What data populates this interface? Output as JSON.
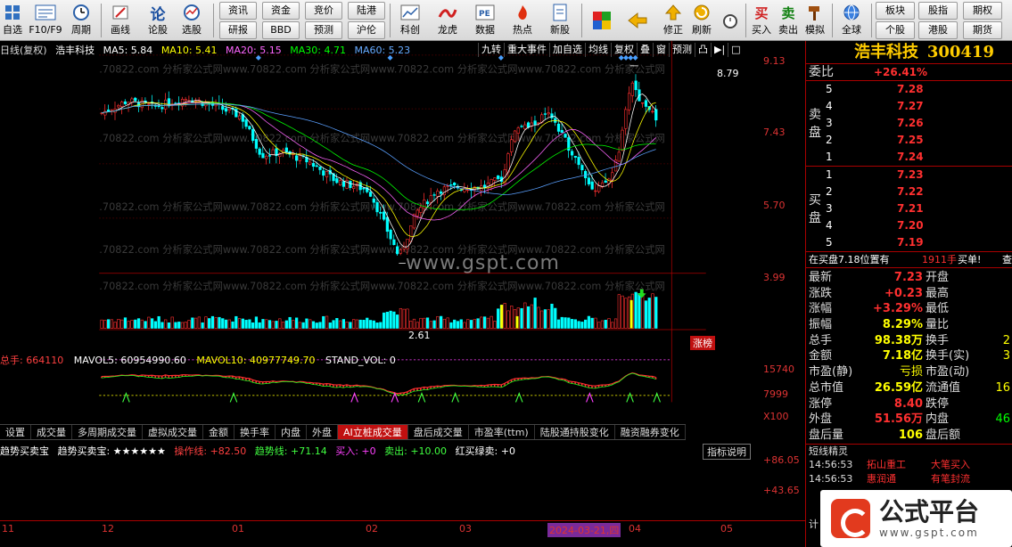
{
  "toolbar": {
    "buttons": [
      {
        "label": "自选",
        "icon": "grid-icon"
      },
      {
        "label": "F10/F9",
        "icon": "f10-icon"
      },
      {
        "label": "周期",
        "icon": "clock-icon"
      },
      {
        "label": "画线",
        "icon": "pencil-icon"
      },
      {
        "label": "论股",
        "icon": "discuss-icon"
      },
      {
        "label": "选股",
        "icon": "radar-icon"
      }
    ],
    "pairs": [
      [
        "资讯",
        "研报"
      ],
      [
        "资金",
        "BBD"
      ],
      [
        "竞价",
        "预测"
      ],
      [
        "陆港",
        "沪伦"
      ]
    ],
    "buttons2": [
      {
        "label": "科创",
        "icon": "chart-icon"
      },
      {
        "label": "龙虎",
        "icon": "dragon-icon"
      },
      {
        "label": "数据",
        "icon": "pe-icon"
      },
      {
        "label": "热点",
        "icon": "fire-icon"
      },
      {
        "label": "新股",
        "icon": "new-stock-icon"
      }
    ],
    "buttons3": [
      {
        "label": "",
        "icon": "layout-icon"
      },
      {
        "label": "",
        "icon": "back-arrow-icon"
      },
      {
        "label": "修正",
        "icon": "up-arrow-icon"
      },
      {
        "label": "刷新",
        "icon": "refresh-icon"
      },
      {
        "label": "",
        "icon": "alarm-clock-icon"
      },
      {
        "label": "买入",
        "icon": "buy-icon"
      },
      {
        "label": "卖出",
        "icon": "sell-icon"
      },
      {
        "label": "模拟",
        "icon": "hammer-icon"
      },
      {
        "label": "全球",
        "icon": "globe-icon"
      }
    ],
    "pairs2": [
      [
        "板块",
        "个股"
      ],
      [
        "股指",
        "港股"
      ],
      [
        "期权",
        "期货"
      ]
    ]
  },
  "chart_header": {
    "period": "日线(复权)",
    "stock": "浩丰科技",
    "ma5": "MA5: 5.84",
    "ma10": "MA10: 5.41",
    "ma20": "MA20: 5.15",
    "ma30": "MA30: 4.71",
    "ma60": "MA60: 5.23",
    "menu": [
      "九转",
      "重大事件",
      "加自选",
      "均线",
      "复权",
      "叠",
      "窗",
      "预测",
      "凸",
      "▶|",
      "□"
    ]
  },
  "price_axis": [
    "9.13",
    "7.43",
    "5.70",
    "3.99"
  ],
  "annotations": {
    "high": "8.79",
    "low": "2.61",
    "tag": "涨榜"
  },
  "watermark": "www.gspt.com",
  "volume_header": {
    "total": "总手: 664110",
    "mavol5": "MAVOL5: 60954990.60",
    "mavol10": "MAVOL10: 40977749.70",
    "stand": "STAND_VOL: 0"
  },
  "volume_axis": [
    "15740",
    "7999",
    "X100"
  ],
  "tabs": [
    "设置",
    "成交量",
    "多周期成交量",
    "虚拟成交量",
    "金额",
    "换手率",
    "内盘",
    "外盘",
    "AI立桩成交量",
    "盘后成交量",
    "市盈率(ttm)",
    "陆股通持股变化",
    "融资融券变化"
  ],
  "active_tab": "AI立桩成交量",
  "indicator_header": {
    "name": "趋势买卖宝",
    "sub": "趋势买卖宝: ★★★★★★",
    "op": "操作线: +82.50",
    "trend": "趋势线: +71.14",
    "buy": "买入: +0",
    "sell": "卖出: +10.00",
    "rb": "红买绿卖: +0",
    "help": "指标说明"
  },
  "indicator_axis": [
    "+86.05",
    "+43.65"
  ],
  "date_axis": [
    "11",
    "12",
    "01",
    "02",
    "03",
    "04",
    "05"
  ],
  "date_highlight": "2024-03-21,四",
  "panel": {
    "name": "浩丰科技",
    "code": "300419",
    "commission_label": "委比",
    "commission_value": "+26.41%",
    "sell_label": "卖盘",
    "buy_label": "买盘",
    "sell_rows": [
      {
        "level": "5",
        "price": "7.28"
      },
      {
        "level": "4",
        "price": "7.27"
      },
      {
        "level": "3",
        "price": "7.26"
      },
      {
        "level": "2",
        "price": "7.25"
      },
      {
        "level": "1",
        "price": "7.24"
      }
    ],
    "buy_rows": [
      {
        "level": "1",
        "price": "7.23"
      },
      {
        "level": "2",
        "price": "7.22"
      },
      {
        "level": "3",
        "price": "7.21"
      },
      {
        "level": "4",
        "price": "7.20"
      },
      {
        "level": "5",
        "price": "7.19"
      }
    ],
    "status": {
      "text": "在买盘7.18位置有",
      "qty": "1911手",
      "action": "买单!",
      "extra": "查"
    },
    "quotes": [
      {
        "l1": "最新",
        "v1": "7.23",
        "l2": "开盘",
        "v2": ""
      },
      {
        "l1": "涨跌",
        "v1": "+0.23",
        "l2": "最高",
        "v2": ""
      },
      {
        "l1": "涨幅",
        "v1": "+3.29%",
        "l2": "最低",
        "v2": ""
      },
      {
        "l1": "振幅",
        "v1": "8.29%",
        "l2": "量比",
        "v2": ""
      },
      {
        "l1": "总手",
        "v1": "98.38万",
        "l2": "换手",
        "v2": "2"
      },
      {
        "l1": "金额",
        "v1": "7.18亿",
        "l2": "换手(实)",
        "v2": "3"
      },
      {
        "l1": "市盈(静)",
        "v1": "亏损",
        "l2": "市盈(动)",
        "v2": ""
      },
      {
        "l1": "总市值",
        "v1": "26.59亿",
        "l2": "流通值",
        "v2": "16"
      },
      {
        "l1": "涨停",
        "v1": "8.40",
        "l2": "跌停",
        "v2": ""
      },
      {
        "l1": "外盘",
        "v1": "51.56万",
        "l2": "内盘",
        "v2": "46"
      },
      {
        "l1": "盘后量",
        "v1": "106",
        "l2": "盘后额",
        "v2": ""
      }
    ],
    "short_title": "短线精灵",
    "short_rows": [
      {
        "time": "14:56:53",
        "name": "拓山重工",
        "event": "大笔买入"
      },
      {
        "time": "14:56:53",
        "name": "惠润通",
        "event": "有笔封流"
      }
    ],
    "footer": "计"
  },
  "logo": {
    "name": "公式平台",
    "url": "www.gspt.com"
  },
  "colors": {
    "up": "#ff3030",
    "down": "#00ffff",
    "ma5": "#ffffff",
    "ma10": "#ffff00",
    "ma20": "#ff66ff",
    "ma30": "#00ff00",
    "ma60": "#5aa0ff"
  }
}
